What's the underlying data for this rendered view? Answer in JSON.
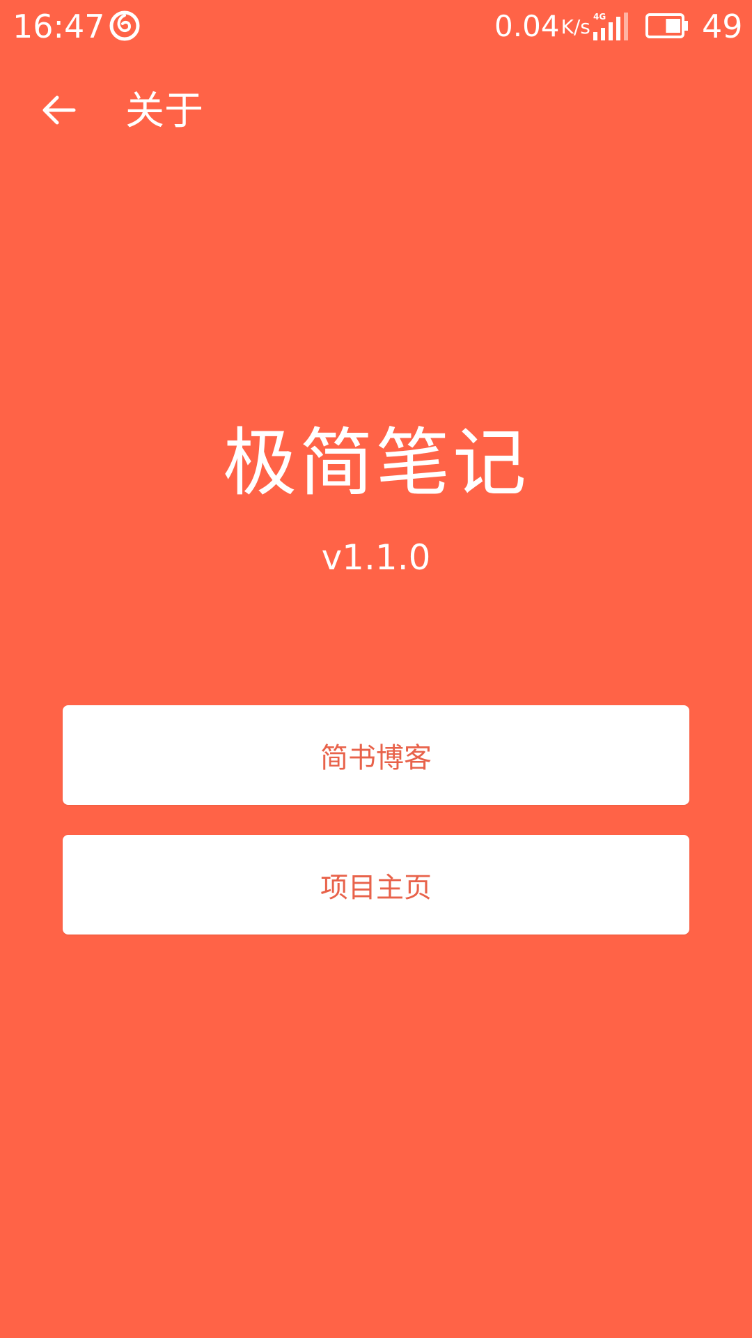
{
  "status_bar": {
    "time": "16:47",
    "net_speed": "0.04",
    "net_speed_unit": "K/s",
    "network_type": "4G",
    "battery_level": "49"
  },
  "toolbar": {
    "title": "关于"
  },
  "about": {
    "app_name": "极简笔记",
    "version": "v1.1.0"
  },
  "buttons": {
    "blog_label": "简书博客",
    "homepage_label": "项目主页"
  },
  "colors": {
    "background": "#FF6347",
    "button_background": "#FFFFFF",
    "button_text": "#E8624A"
  },
  "icons": {
    "status_app": "netease-music-icon",
    "signal": "signal-4g-icon",
    "battery": "battery-icon",
    "back": "arrow-back-icon"
  }
}
